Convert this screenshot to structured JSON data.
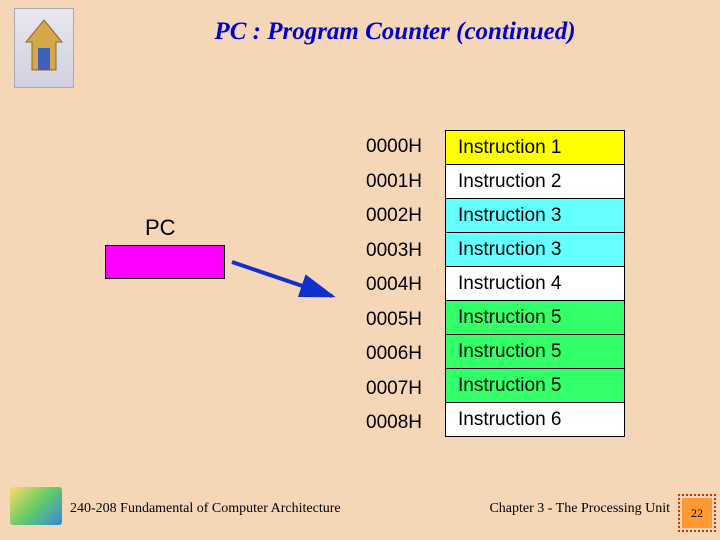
{
  "title": "PC : Program Counter (continued)",
  "pc_label": "PC",
  "addresses": [
    "0000H",
    "0001H",
    "0002H",
    "0003H",
    "0004H",
    "0005H",
    "0006H",
    "0007H",
    "0008H"
  ],
  "instructions": [
    {
      "label": "Instruction 1",
      "color": "#ffff00"
    },
    {
      "label": "Instruction 2",
      "color": "#ffffff"
    },
    {
      "label": "Instruction 3",
      "color": "#66ffff"
    },
    {
      "label": "Instruction 3",
      "color": "#66ffff"
    },
    {
      "label": "Instruction 4",
      "color": "#ffffff"
    },
    {
      "label": "Instruction 5",
      "color": "#33ff66"
    },
    {
      "label": "Instruction 5",
      "color": "#33ff66"
    },
    {
      "label": "Instruction 5",
      "color": "#33ff66"
    },
    {
      "label": "Instruction 6",
      "color": "#ffffff"
    }
  ],
  "footer": {
    "left": "240-208 Fundamental of Computer Architecture",
    "right": "Chapter 3 - The Processing Unit",
    "page": "22"
  }
}
